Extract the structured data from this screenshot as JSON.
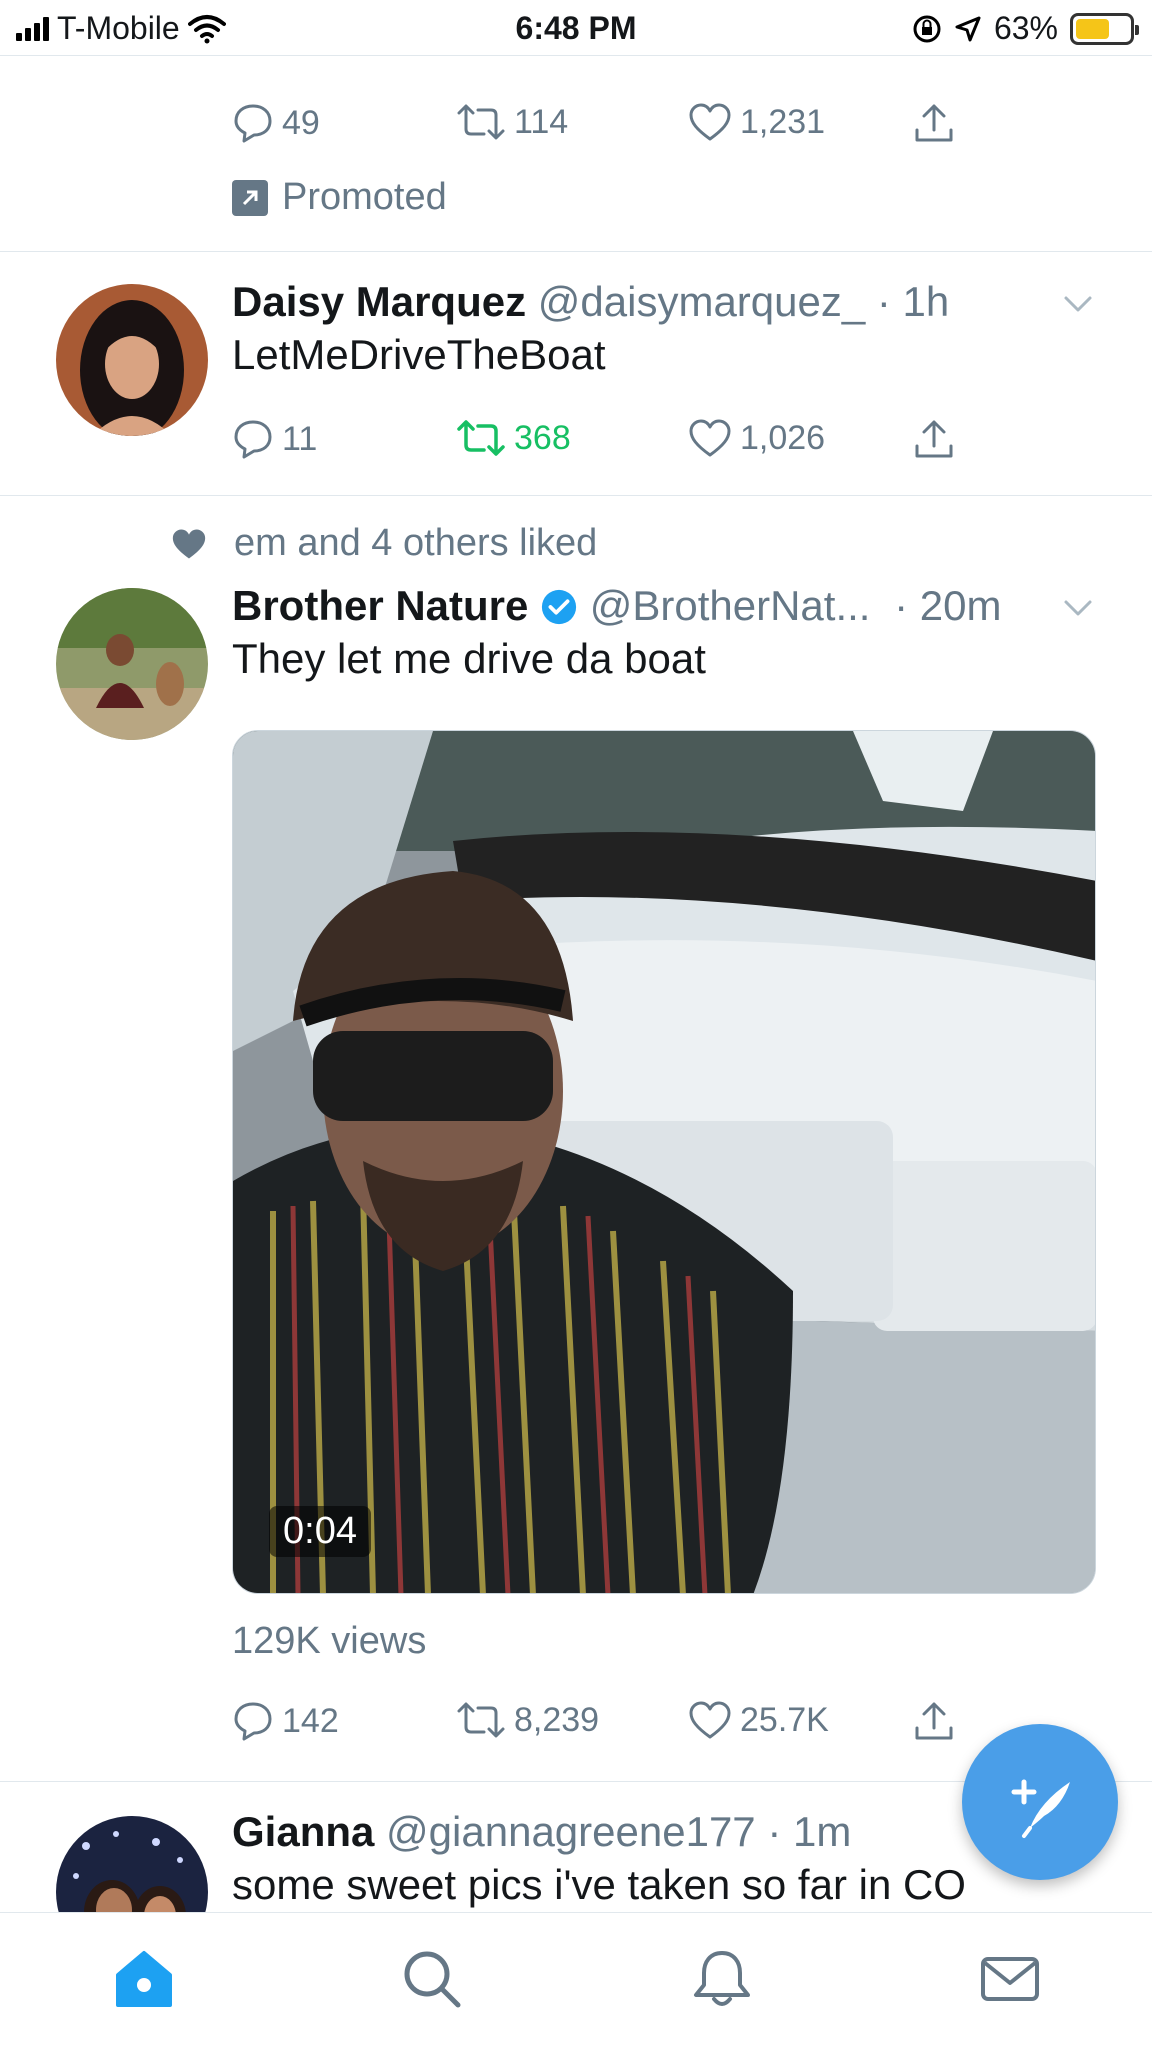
{
  "status_bar": {
    "carrier": "T-Mobile",
    "time": "6:48 PM",
    "battery": "63%",
    "battery_level": 0.63
  },
  "promoted_tweet": {
    "replies": "49",
    "retweets": "114",
    "likes": "1,231",
    "promoted_label": "Promoted"
  },
  "tweet1": {
    "name": "Daisy Marquez",
    "handle": "@daisymarquez_",
    "time": "· 1h",
    "text": "LetMeDriveTheBoat",
    "replies": "11",
    "retweets": "368",
    "likes": "1,026"
  },
  "tweet2": {
    "social_context": "em and 4 others liked",
    "name": "Brother Nature",
    "handle": "@BrotherNat...",
    "time": "· 20m",
    "text": "They let me drive da boat",
    "video_duration": "0:04",
    "views": "129K views",
    "replies": "142",
    "retweets": "8,239",
    "likes": "25.7K"
  },
  "tweet3": {
    "name": "Gianna",
    "handle": "@giannagreene177",
    "time": "· 1m",
    "text": "some sweet pics i've taken so far in CO"
  },
  "icons": {
    "status": [
      "signal-icon",
      "wifi-icon",
      "orientation-lock-icon",
      "location-icon",
      "battery-icon"
    ],
    "actions": [
      "reply-icon",
      "retweet-icon",
      "like-icon",
      "share-icon"
    ],
    "tabs": [
      "home-icon",
      "search-icon",
      "notifications-icon",
      "messages-icon"
    ],
    "fab": "compose-tweet-icon"
  },
  "colors": {
    "accent": "#1da1f2",
    "retweet_active": "#17bf63",
    "muted": "#657786",
    "fab": "#4a9ee8"
  }
}
